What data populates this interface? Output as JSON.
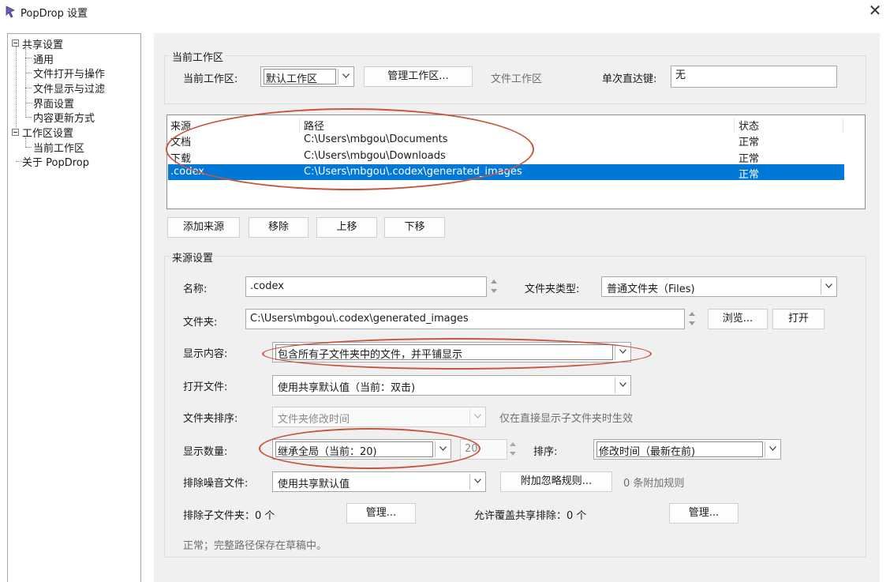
{
  "window": {
    "title": "PopDrop 设置",
    "icon": "popdrop-app-icon",
    "close_icon": "close-icon"
  },
  "tree": {
    "items": [
      {
        "label": "共享设置"
      },
      {
        "label": "通用"
      },
      {
        "label": "文件打开与操作"
      },
      {
        "label": "文件显示与过滤"
      },
      {
        "label": "界面设置"
      },
      {
        "label": "内容更新方式"
      },
      {
        "label": "工作区设置"
      },
      {
        "label": "当前工作区"
      },
      {
        "label": "关于 PopDrop"
      }
    ]
  },
  "workspace": {
    "group_label": "当前工作区",
    "current_label": "当前工作区:",
    "current_value": "默认工作区",
    "manage_button": "管理工作区...",
    "file_workspace_label": "文件工作区",
    "hotkey_label": "单次直达键:",
    "hotkey_value": "无"
  },
  "sources_table": {
    "headers": [
      "来源",
      "路径",
      "状态"
    ],
    "rows": [
      {
        "source": "文档",
        "path": "C:\\Users\\mbgou\\Documents",
        "status": "正常",
        "selected": false
      },
      {
        "source": "下载",
        "path": "C:\\Users\\mbgou\\Downloads",
        "status": "正常",
        "selected": false
      },
      {
        "source": ".codex",
        "path": "C:\\Users\\mbgou\\.codex\\generated_images",
        "status": "正常",
        "selected": true
      }
    ]
  },
  "list_buttons": {
    "add": "添加来源",
    "remove": "移除",
    "up": "上移",
    "down": "下移"
  },
  "source_settings": {
    "group_label": "来源设置",
    "name_label": "名称:",
    "name_value": ".codex",
    "folder_type_label": "文件夹类型:",
    "folder_type_value": "普通文件夹（Files)",
    "folder_label": "文件夹:",
    "folder_value": "C:\\Users\\mbgou\\.codex\\generated_images",
    "browse_button": "浏览...",
    "open_button": "打开",
    "display_content_label": "显示内容:",
    "display_content_value": "包含所有子文件夹中的文件，并平铺显示",
    "open_file_label": "打开文件:",
    "open_file_value": "使用共享默认值（当前：双击)",
    "folder_sort_label": "文件夹排序:",
    "folder_sort_value": "文件夹修改时间",
    "folder_sort_hint": "仅在直接显示子文件夹时生效",
    "display_count_label": "显示数量:",
    "display_count_value": "继承全局（当前：20)",
    "display_count_number": "20",
    "sort_label": "排序:",
    "sort_value": "修改时间（最新在前)",
    "exclude_noise_label": "排除噪音文件:",
    "exclude_noise_value": "使用共享默认值",
    "ignore_rules_button": "附加忽略规则...",
    "ignore_rules_count": "0 条附加规则",
    "exclude_subfolders_label": "排除子文件夹：0 个",
    "manage_button_1": "管理...",
    "allow_override_label": "允许覆盖共享排除：0 个",
    "manage_button_2": "管理...",
    "status_text": "正常；完整路径保存在草稿中。"
  },
  "colors": {
    "selection": "#0078d7",
    "annotation": "#c8553d",
    "panel_bg": "#f0f0f0"
  }
}
